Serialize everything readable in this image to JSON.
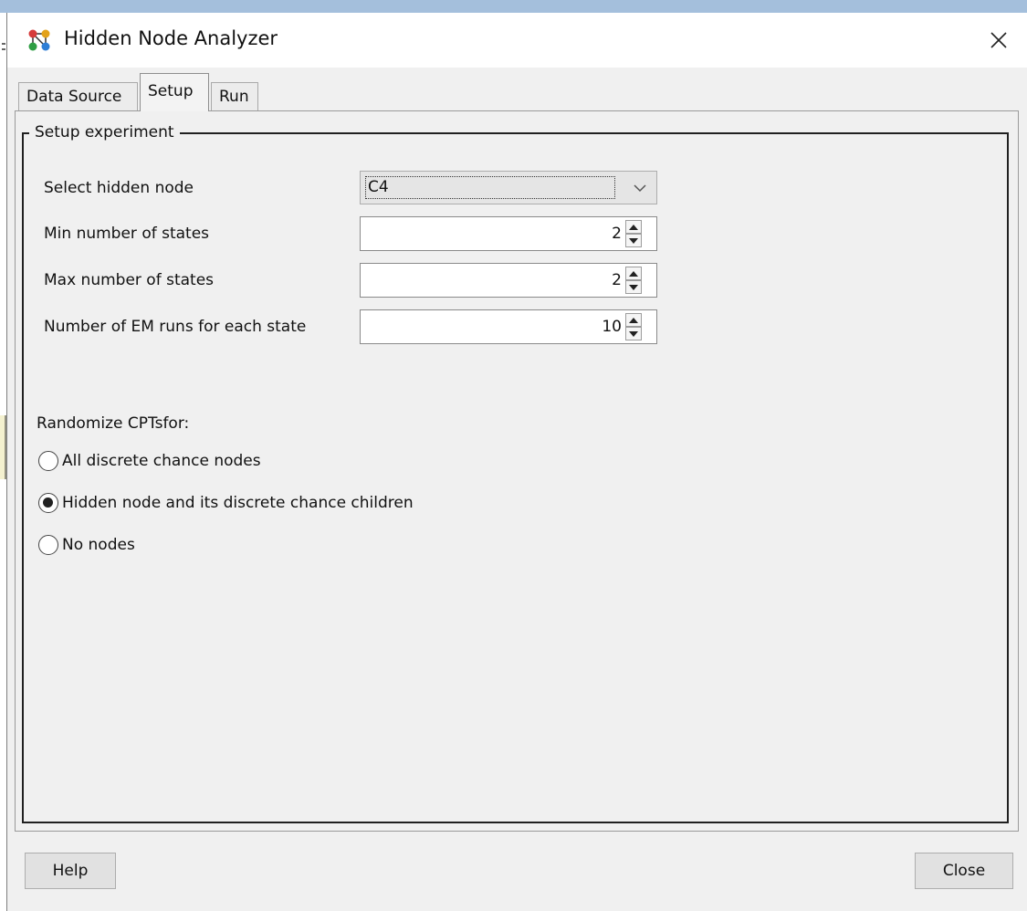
{
  "window": {
    "title": "Hidden Node Analyzer",
    "close_glyph": "✕"
  },
  "tabs": [
    {
      "label": "Data Source",
      "active": false
    },
    {
      "label": "Setup",
      "active": true
    },
    {
      "label": "Run",
      "active": false
    }
  ],
  "setup": {
    "group_title": "Setup experiment",
    "hidden_node": {
      "label": "Select hidden node",
      "value": "C4"
    },
    "min_states": {
      "label": "Min number of states",
      "value": "2"
    },
    "max_states": {
      "label": "Max number of states",
      "value": "2"
    },
    "em_runs": {
      "label": "Number of EM runs for each state",
      "value": "10"
    },
    "randomize_label": "Randomize CPTsfor:",
    "options": [
      {
        "label": "All discrete chance nodes",
        "checked": false
      },
      {
        "label": "Hidden node and its discrete chance children",
        "checked": true
      },
      {
        "label": "No nodes",
        "checked": false
      }
    ]
  },
  "footer": {
    "help_label": "Help",
    "close_label": "Close"
  },
  "colors": {
    "title_strip": "#a4bfdc",
    "dialog_bg": "#f0f0f0",
    "button_bg": "#e1e1e1"
  },
  "icons": {
    "app": "network-graph-icon",
    "close": "close-icon",
    "combo_arrow": "chevron-down-icon",
    "spin_up": "caret-up-icon",
    "spin_down": "caret-down-icon"
  }
}
